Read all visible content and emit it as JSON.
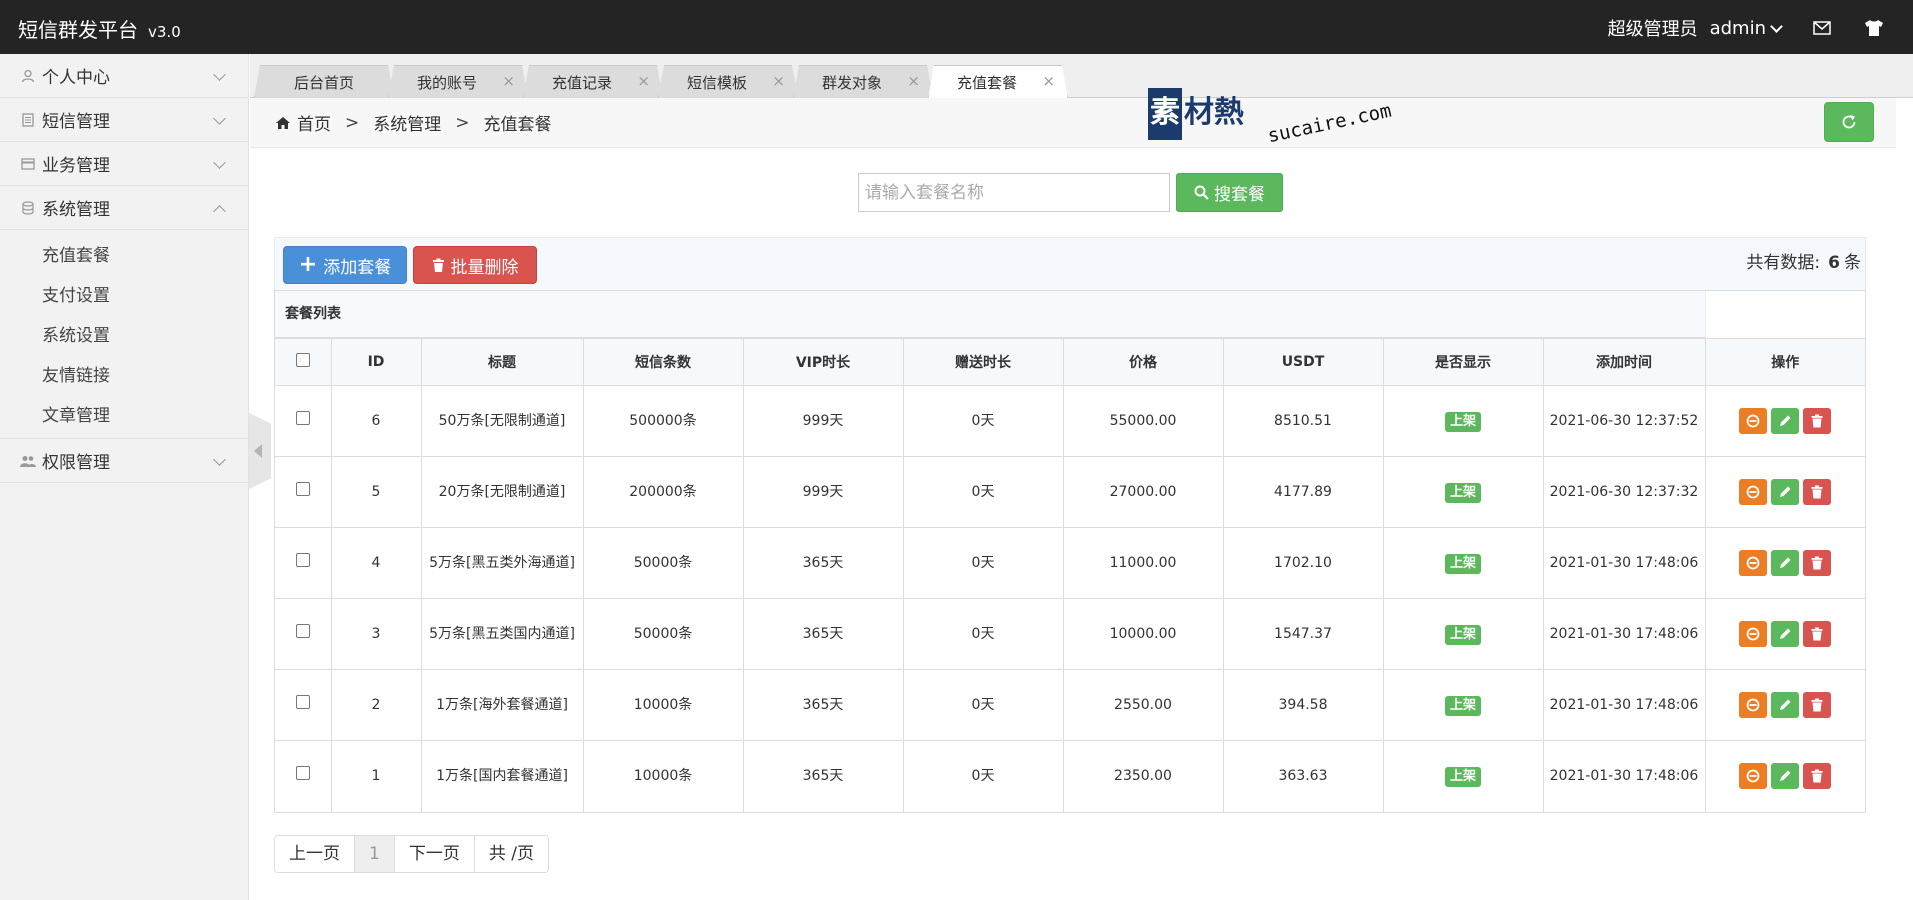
{
  "header": {
    "app_title": "短信群发平台",
    "version": "v3.0",
    "role": "超级管理员",
    "username": "admin",
    "icons": [
      "envelope-icon",
      "shirt-icon"
    ]
  },
  "sidebar": {
    "items": [
      {
        "label": "个人中心",
        "icon": "user-icon",
        "expanded": false
      },
      {
        "label": "短信管理",
        "icon": "document-icon",
        "expanded": false
      },
      {
        "label": "业务管理",
        "icon": "card-icon",
        "expanded": false
      },
      {
        "label": "系统管理",
        "icon": "database-icon",
        "expanded": true
      },
      {
        "label": "权限管理",
        "icon": "users-icon",
        "expanded": false
      }
    ],
    "submenu": [
      "充值套餐",
      "支付设置",
      "系统设置",
      "友情链接",
      "文章管理"
    ]
  },
  "tabs": [
    {
      "label": "后台首页",
      "closable": false
    },
    {
      "label": "我的账号",
      "closable": true
    },
    {
      "label": "充值记录",
      "closable": true
    },
    {
      "label": "短信模板",
      "closable": true
    },
    {
      "label": "群发对象",
      "closable": true
    },
    {
      "label": "充值套餐",
      "closable": true,
      "active": true
    }
  ],
  "tab_close_glyph": "×",
  "breadcrumb": {
    "items": [
      "首页",
      "系统管理",
      "充值套餐"
    ],
    "separator": ">"
  },
  "watermark": {
    "cn": "素材熱",
    "en": "sucaire.com"
  },
  "search": {
    "placeholder": "请输入套餐名称",
    "button_label": "搜套餐"
  },
  "toolbar": {
    "add_label": "添加套餐",
    "batch_delete_label": "批量删除",
    "total_prefix": "共有数据:",
    "total_count": "6",
    "total_suffix": "条"
  },
  "table": {
    "caption": "套餐列表",
    "columns": [
      "",
      "ID",
      "标题",
      "短信条数",
      "VIP时长",
      "赠送时长",
      "价格",
      "USDT",
      "是否显示",
      "添加时间",
      "操作"
    ],
    "rows": [
      {
        "id": "6",
        "title": "50万条[无限制通道]",
        "count": "500000条",
        "vip": "999天",
        "gift": "0天",
        "price": "55000.00",
        "usdt": "8510.51",
        "status": "上架",
        "time": "2021-06-30 12:37:52"
      },
      {
        "id": "5",
        "title": "20万条[无限制通道]",
        "count": "200000条",
        "vip": "999天",
        "gift": "0天",
        "price": "27000.00",
        "usdt": "4177.89",
        "status": "上架",
        "time": "2021-06-30 12:37:32"
      },
      {
        "id": "4",
        "title": "5万条[黑五类外海通道]",
        "count": "50000条",
        "vip": "365天",
        "gift": "0天",
        "price": "11000.00",
        "usdt": "1702.10",
        "status": "上架",
        "time": "2021-01-30 17:48:06"
      },
      {
        "id": "3",
        "title": "5万条[黑五类国内通道]",
        "count": "50000条",
        "vip": "365天",
        "gift": "0天",
        "price": "10000.00",
        "usdt": "1547.37",
        "status": "上架",
        "time": "2021-01-30 17:48:06"
      },
      {
        "id": "2",
        "title": "1万条[海外套餐通道]",
        "count": "10000条",
        "vip": "365天",
        "gift": "0天",
        "price": "2550.00",
        "usdt": "394.58",
        "status": "上架",
        "time": "2021-01-30 17:48:06"
      },
      {
        "id": "1",
        "title": "1万条[国内套餐通道]",
        "count": "10000条",
        "vip": "365天",
        "gift": "0天",
        "price": "2350.00",
        "usdt": "363.63",
        "status": "上架",
        "time": "2021-01-30 17:48:06"
      }
    ],
    "row_actions": [
      "ban-icon",
      "edit-icon",
      "trash-icon"
    ]
  },
  "pagination": {
    "prev": "上一页",
    "current": "1",
    "next": "下一页",
    "total": "共 /页"
  },
  "colors": {
    "header_bg": "#242424",
    "primary_blue": "#4a90d9",
    "success_green": "#5cb85c",
    "danger_red": "#d9534f",
    "warning_orange": "#ed7d22"
  }
}
